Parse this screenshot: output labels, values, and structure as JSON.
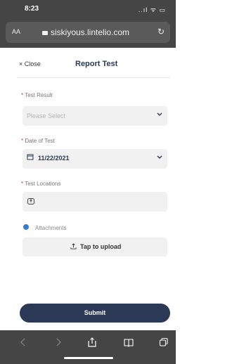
{
  "status_bar": {
    "time": "8:23",
    "signal_indicators": "..ıl ᯤ ▭"
  },
  "browser": {
    "aa_label": "AA",
    "url": "siskiyous.lintelio.com",
    "reload_label": "↻"
  },
  "header": {
    "close_label": "× Close",
    "title": "Report Test"
  },
  "form": {
    "test_result": {
      "label": "Test Result",
      "placeholder": "Please Select"
    },
    "date_of_test": {
      "label": "Date of Test",
      "value": "11/22/2021"
    },
    "test_locations": {
      "label": "Test Locations"
    },
    "attachments": {
      "label": "Attachments",
      "upload_label": "Tap to upload"
    },
    "submit_label": "Submit"
  }
}
